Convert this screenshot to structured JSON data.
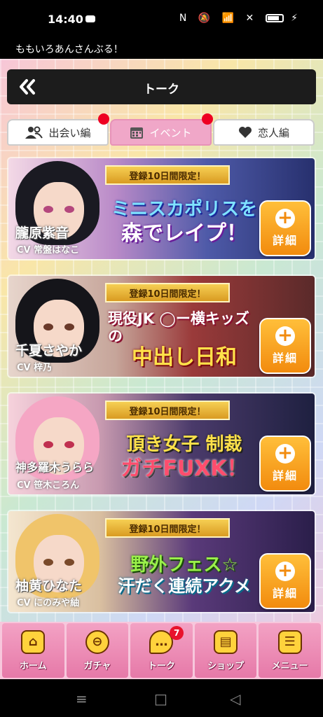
{
  "status_bar": {
    "time": "14:40",
    "icons": "N 🔕 📶 ✕",
    "charging": "⚡"
  },
  "app": {
    "name": "ももいろあんさんぶる！"
  },
  "header": {
    "back_icon": "double-chevron-left-icon",
    "title": "トーク"
  },
  "tabs": [
    {
      "label": "出会い編",
      "icon": "people-icon",
      "active": false,
      "has_dot": false
    },
    {
      "label": "イベント",
      "icon": "calendar-icon",
      "active": true,
      "has_dot": true
    },
    {
      "label": "恋人編",
      "icon": "heart-icon",
      "active": false,
      "has_dot": false
    }
  ],
  "tab_dot_color": "#ee0022",
  "banners": [
    {
      "limited": "登録10日間限定！",
      "title_line1": "ミニスカポリスを",
      "title_line2": "森でレイプ！",
      "character_name": "朧原紫音",
      "cv": "CV 常盤はなこ",
      "detail_label": "詳細"
    },
    {
      "limited": "登録10日間限定！",
      "title_line1": "現役JK ◯ー横キッズの",
      "title_line2": "中出し日和",
      "character_name": "千夏さやか",
      "cv": "CV 梓乃",
      "detail_label": "詳細"
    },
    {
      "limited": "登録10日間限定！",
      "title_line1": "頂き女子 制裁",
      "title_line2": "ガチFUXK！",
      "character_name": "神多羅木うらら",
      "cv": "CV 笹木ころん",
      "detail_label": "詳細"
    },
    {
      "limited": "登録10日間限定！",
      "title_line1": "野外フェス☆",
      "title_line2": "汗だく連続アクメ",
      "character_name": "柚黄ひなた",
      "cv": "CV にのみや紬",
      "detail_label": "詳細"
    }
  ],
  "bottom_nav": [
    {
      "label": "ホーム",
      "icon": "home-icon",
      "badge": ""
    },
    {
      "label": "ガチャ",
      "icon": "gacha-icon",
      "badge": ""
    },
    {
      "label": "トーク",
      "icon": "chat-icon",
      "badge": "7"
    },
    {
      "label": "ショップ",
      "icon": "shop-icon",
      "badge": ""
    },
    {
      "label": "メニュー",
      "icon": "menu-icon",
      "badge": ""
    }
  ],
  "system_nav": {
    "menu": "≡",
    "home": "□",
    "back": "◁"
  },
  "colors": {
    "detail_button": "#f28b0e",
    "nav_pink": "#e679a8",
    "badge_red": "#e8132c",
    "active_tab": "#f0a7c8"
  }
}
